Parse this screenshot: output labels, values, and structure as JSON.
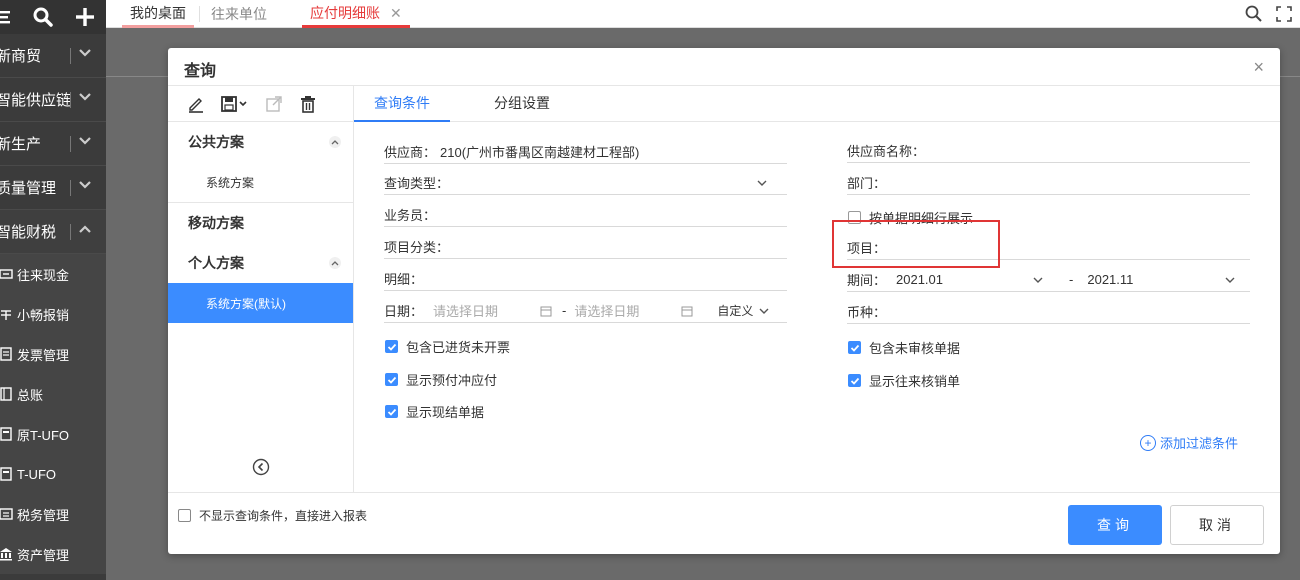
{
  "sidebar": {
    "groups": [
      {
        "label": "新商贸",
        "expanded": false
      },
      {
        "label": "智能供应链",
        "expanded": false
      },
      {
        "label": "新生产",
        "expanded": false
      },
      {
        "label": "质量管理",
        "expanded": false
      },
      {
        "label": "智能财税",
        "expanded": true
      }
    ],
    "sub_items": [
      {
        "label": "往来现金",
        "icon": "cash-icon"
      },
      {
        "label": "小畅报销",
        "icon": "reimburse-icon"
      },
      {
        "label": "发票管理",
        "icon": "invoice-icon"
      },
      {
        "label": "总账",
        "icon": "ledger-icon"
      },
      {
        "label": "原T-UFO",
        "icon": "report-icon"
      },
      {
        "label": "T-UFO",
        "icon": "report-icon"
      },
      {
        "label": "税务管理",
        "icon": "tax-icon"
      },
      {
        "label": "资产管理",
        "icon": "asset-icon"
      }
    ]
  },
  "tabs": [
    {
      "label": "我的桌面"
    },
    {
      "label": "往来单位"
    },
    {
      "label": "应付明细账",
      "active": true
    }
  ],
  "modal": {
    "title": "查询",
    "close": "×",
    "schemes": {
      "public": {
        "label": "公共方案",
        "items": [
          "系统方案"
        ]
      },
      "mobile": {
        "label": "移动方案"
      },
      "personal": {
        "label": "个人方案",
        "items": [
          "系统方案(默认)"
        ]
      }
    },
    "form_tabs": {
      "conditions": "查询条件",
      "grouping": "分组设置"
    },
    "fields": {
      "supplier": {
        "label": "供应商：",
        "value": "210(广州市番禺区南越建材工程部)"
      },
      "query_type": {
        "label": "查询类型："
      },
      "salesman": {
        "label": "业务员："
      },
      "project_category": {
        "label": "项目分类："
      },
      "detail": {
        "label": "明细："
      },
      "date": {
        "label": "日期：",
        "start_placeholder": "请选择日期",
        "dash": "-",
        "end_placeholder": "请选择日期",
        "mode": "自定义"
      },
      "supplier_name": {
        "label": "供应商名称："
      },
      "department": {
        "label": "部门："
      },
      "by_line": {
        "label": "按单据明细行展示"
      },
      "project": {
        "label": "项目："
      },
      "period": {
        "label": "期间：",
        "start": "2021.01",
        "dash": "-",
        "end": "2021.11"
      },
      "currency": {
        "label": "币种："
      }
    },
    "checks_left": [
      {
        "label": "包含已进货未开票",
        "checked": true
      },
      {
        "label": "显示预付冲应付",
        "checked": true
      },
      {
        "label": "显示现结单据",
        "checked": true
      }
    ],
    "checks_right": [
      {
        "label": "包含未审核单据",
        "checked": true
      },
      {
        "label": "显示往来核销单",
        "checked": true
      }
    ],
    "add_filter": "添加过滤条件",
    "footer": {
      "skip_label": "不显示查询条件，直接进入报表",
      "query_button": "查询",
      "cancel_button": "取消"
    }
  },
  "colors": {
    "accent": "#3b8cff",
    "tab_active": "#e63b3b",
    "highlight": "#e03535"
  }
}
